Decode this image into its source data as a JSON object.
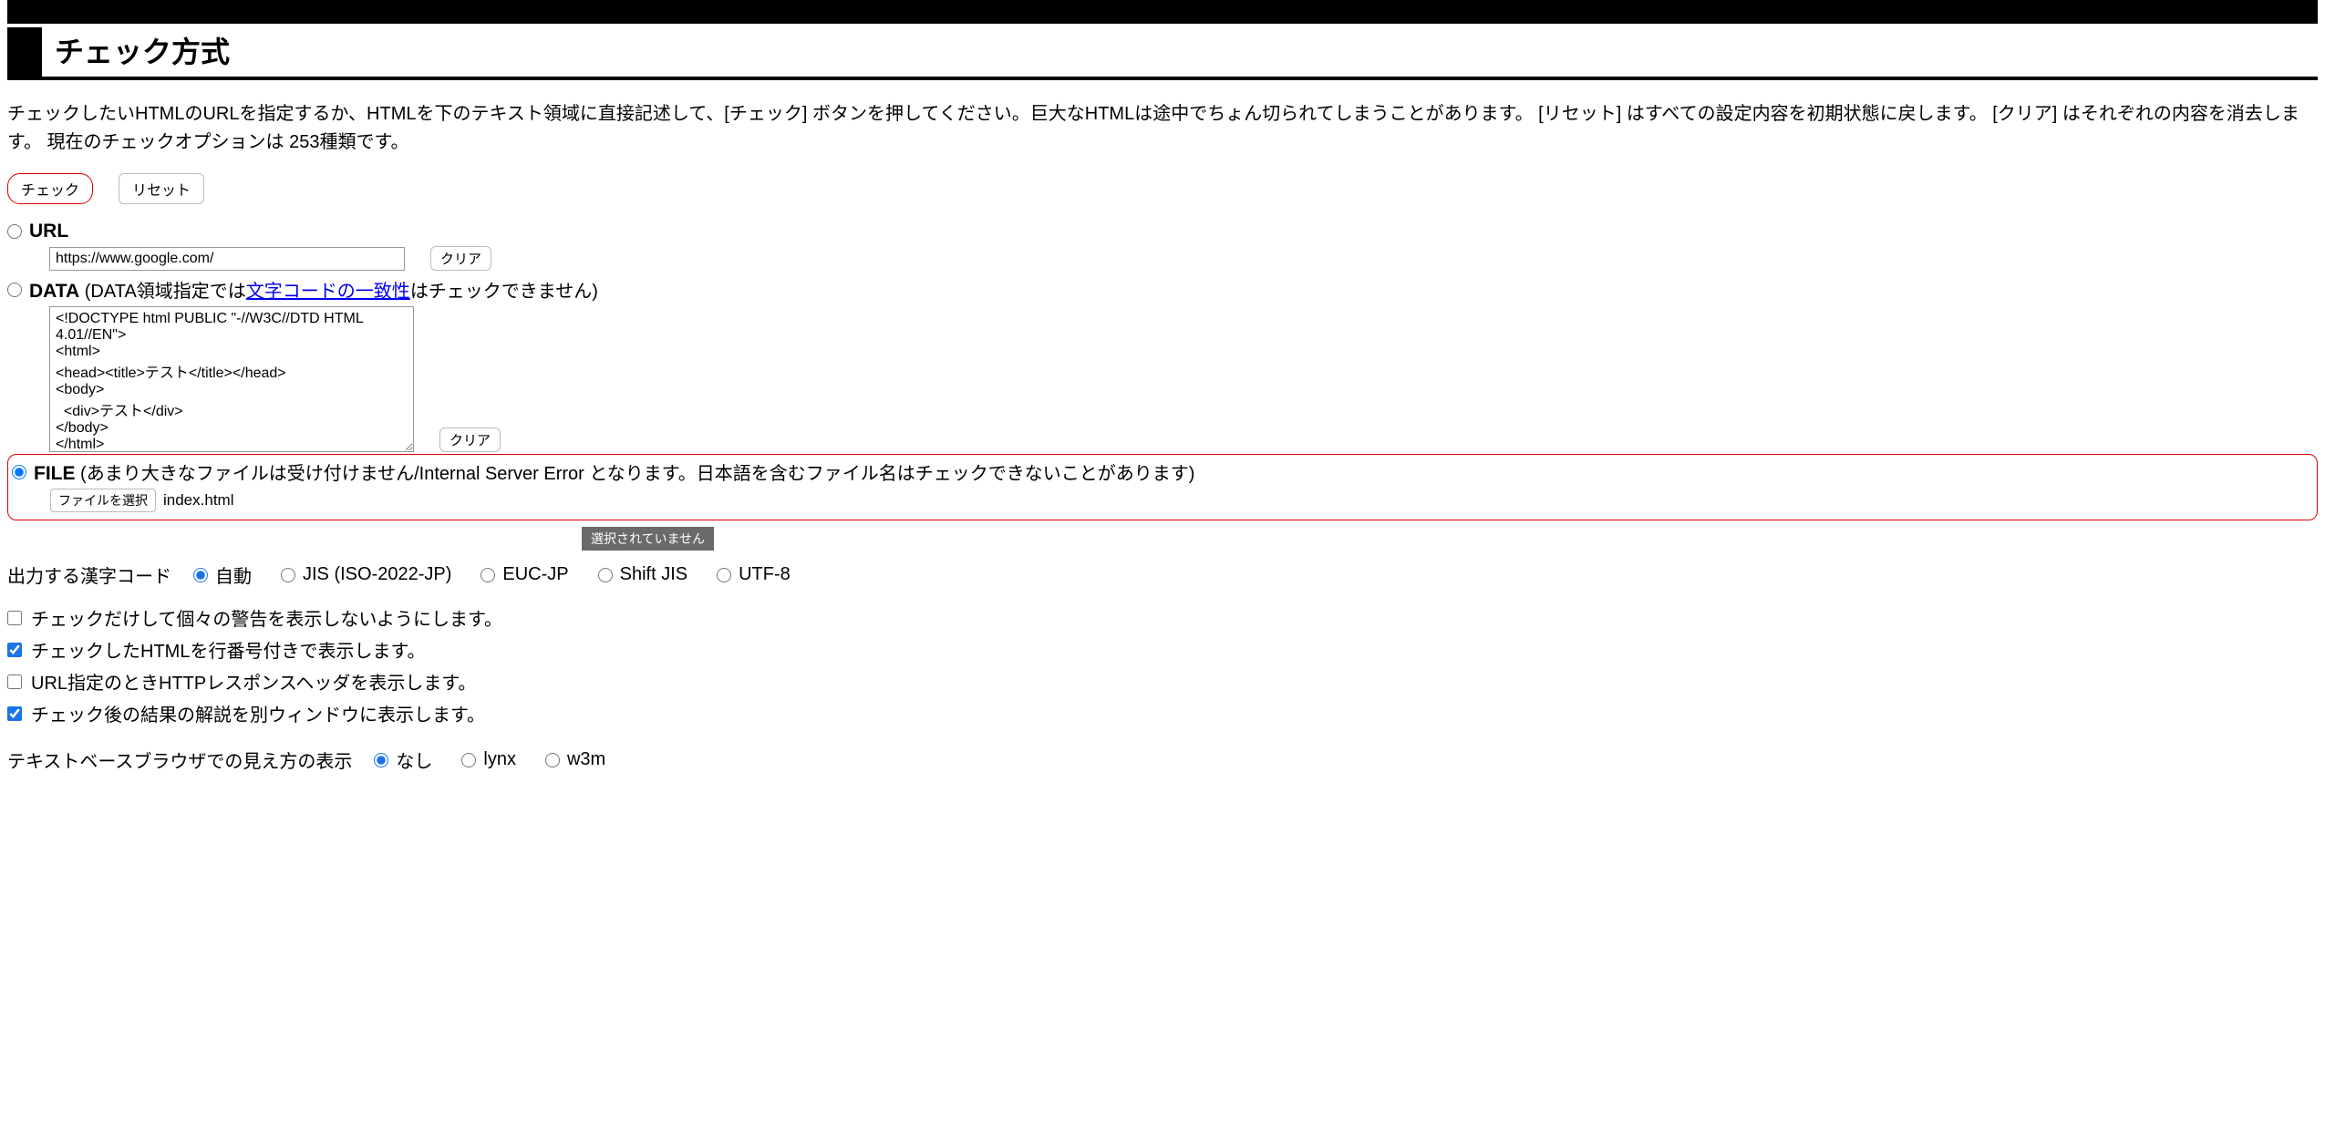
{
  "title": "チェック方式",
  "intro": "チェックしたいHTMLのURLを指定するか、HTMLを下のテキスト領域に直接記述して、[チェック] ボタンを押してください。巨大なHTMLは途中でちょん切られてしまうことがあります。 [リセット] はすべての設定内容を初期状態に戻します。 [クリア] はそれぞれの内容を消去します。 現在のチェックオプションは 253種類です。",
  "buttons": {
    "check": "チェック",
    "reset": "リセット",
    "clear": "クリア"
  },
  "url": {
    "label": "URL",
    "value": "https://www.google.com/"
  },
  "data": {
    "label": "DATA",
    "note_pre": " (DATA領域指定では",
    "note_link": "文字コードの一致性",
    "note_post": "はチェックできません)",
    "value": "<!DOCTYPE html PUBLIC \"-//W3C//DTD HTML 4.01//EN\">\n<html>\n<head><title>テスト</title></head>\n<body>\n  <div>テスト</div>\n</body>\n</html>"
  },
  "file": {
    "label": "FILE",
    "note": " (あまり大きなファイルは受け付けません/Internal Server Error となります。日本語を含むファイル名はチェックできないことがあります)",
    "choose": "ファイルを選択",
    "name": "index.html"
  },
  "tooltip": "選択されていません",
  "charset": {
    "label": "出力する漢字コード",
    "options": [
      "自動",
      "JIS (ISO-2022-JP)",
      "EUC-JP",
      "Shift JIS",
      "UTF-8"
    ]
  },
  "checks": [
    "チェックだけして個々の警告を表示しないようにします。",
    "チェックしたHTMLを行番号付きで表示します。",
    "URL指定のときHTTPレスポンスヘッダを表示します。",
    "チェック後の結果の解説を別ウィンドウに表示します。"
  ],
  "textbrowser": {
    "label": "テキストベースブラウザでの見え方の表示",
    "options": [
      "なし",
      "lynx",
      "w3m"
    ]
  }
}
